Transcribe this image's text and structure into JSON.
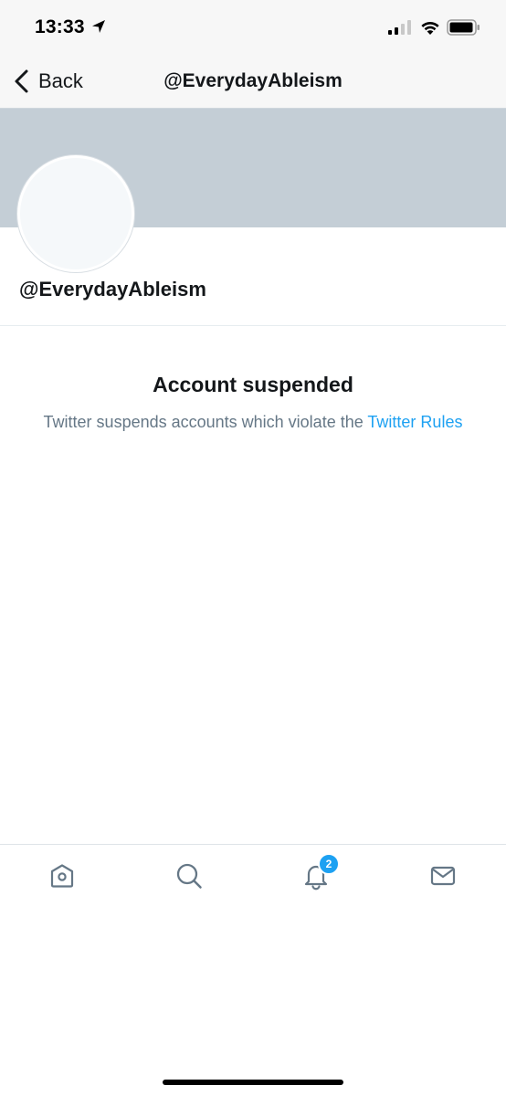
{
  "status_bar": {
    "time": "13:33"
  },
  "nav": {
    "back_label": "Back",
    "title": "@EverydayAbleism"
  },
  "profile": {
    "handle": "@EverydayAbleism"
  },
  "suspension": {
    "title": "Account suspended",
    "message": "Twitter suspends accounts which violate the",
    "link_text": "Twitter Rules"
  },
  "tab_bar": {
    "notifications_count": "2",
    "icons": [
      "home-icon",
      "search-icon",
      "bell-icon",
      "mail-icon"
    ]
  },
  "colors": {
    "banner": "#c4ced6",
    "link": "#1da1f2",
    "badge": "#1da1f2",
    "secondary_text": "#657786"
  }
}
